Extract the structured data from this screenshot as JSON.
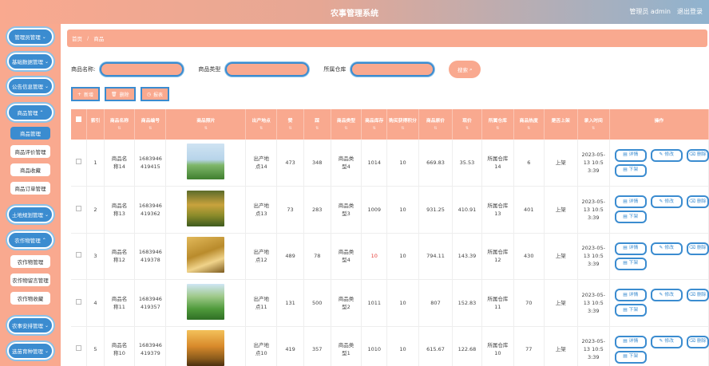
{
  "header": {
    "title": "农事管理系统",
    "user": "管理员 admin",
    "logout": "退出登录"
  },
  "sidebar": {
    "menus": [
      {
        "label": "管理员管理",
        "expanded": false
      },
      {
        "label": "基础数据管理",
        "expanded": false
      },
      {
        "label": "公告信息管理",
        "expanded": false
      },
      {
        "label": "商品管理",
        "expanded": true
      },
      {
        "label": "土地规划管理",
        "expanded": false
      },
      {
        "label": "农作物管理",
        "expanded": true
      },
      {
        "label": "农事安排管理",
        "expanded": false
      },
      {
        "label": "选苗育种管理",
        "expanded": false
      }
    ],
    "goods_sub": [
      "商品管理",
      "商品评价管理",
      "商品收藏",
      "商品订单管理"
    ],
    "crop_sub": [
      "农作物管理",
      "农作物留言管理",
      "农作物收藏"
    ]
  },
  "breadcrumb": {
    "home": "首页",
    "current": "商品"
  },
  "search": {
    "name_label": "商品名称:",
    "type_label": "商品类型",
    "warehouse_label": "所属仓库",
    "button": "搜索"
  },
  "actions": {
    "add": "新增",
    "delete": "删除",
    "report": "报表"
  },
  "table": {
    "columns": [
      "索引",
      "商品名称",
      "商品编号",
      "商品照片",
      "出产地点",
      "赞",
      "踩",
      "商品类型",
      "商品库存",
      "购买获得积分",
      "商品原价",
      "现价",
      "所属仓库",
      "商品热度",
      "是否上架",
      "录入时间",
      "操作"
    ],
    "rows": [
      {
        "idx": "1",
        "name": "商品名称14",
        "code": "1683946419415",
        "place": "出产地点14",
        "likes": "473",
        "dislikes": "348",
        "type": "商品类型4",
        "stock": "1014",
        "points": "10",
        "price": "669.83",
        "now": "35.53",
        "warehouse": "所属仓库14",
        "heat": "6",
        "shelf": "上架",
        "time": "2023-05-13 10:53:39",
        "photo": "sky-field"
      },
      {
        "idx": "2",
        "name": "商品名称13",
        "code": "1683946419362",
        "place": "出产地点13",
        "likes": "73",
        "dislikes": "283",
        "type": "商品类型3",
        "stock": "1009",
        "points": "10",
        "price": "931.25",
        "now": "410.91",
        "warehouse": "所属仓库13",
        "heat": "401",
        "shelf": "上架",
        "time": "2023-05-13 10:53:39",
        "photo": "rice"
      },
      {
        "idx": "3",
        "name": "商品名称12",
        "code": "1683946419378",
        "place": "出产地点12",
        "likes": "489",
        "dislikes": "78",
        "type": "商品类型4",
        "stock": "10",
        "points": "10",
        "price": "794.11",
        "now": "143.39",
        "warehouse": "所属仓库12",
        "heat": "430",
        "shelf": "上架",
        "time": "2023-05-13 10:53:39",
        "photo": "wheat",
        "stock_low": true
      },
      {
        "idx": "4",
        "name": "商品名称11",
        "code": "1683946419357",
        "place": "出产地点11",
        "likes": "131",
        "dislikes": "500",
        "type": "商品类型2",
        "stock": "1011",
        "points": "10",
        "price": "807",
        "now": "152.83",
        "warehouse": "所属仓库11",
        "heat": "70",
        "shelf": "上架",
        "time": "2023-05-13 10:53:39",
        "photo": "green-field"
      },
      {
        "idx": "5",
        "name": "商品名称10",
        "code": "1683946419379",
        "place": "出产地点10",
        "likes": "419",
        "dislikes": "357",
        "type": "商品类型1",
        "stock": "1010",
        "points": "10",
        "price": "615.67",
        "now": "122.68",
        "warehouse": "所属仓库10",
        "heat": "77",
        "shelf": "上架",
        "time": "2023-05-13 10:53:39",
        "photo": "sunset-wheat"
      }
    ],
    "ops": {
      "detail": "详情",
      "edit": "修改",
      "delete": "删除",
      "off": "下架"
    }
  },
  "colors": {
    "accent": "#f9a98f",
    "primary": "#3b8cd0",
    "stock_low": "#e53935"
  }
}
